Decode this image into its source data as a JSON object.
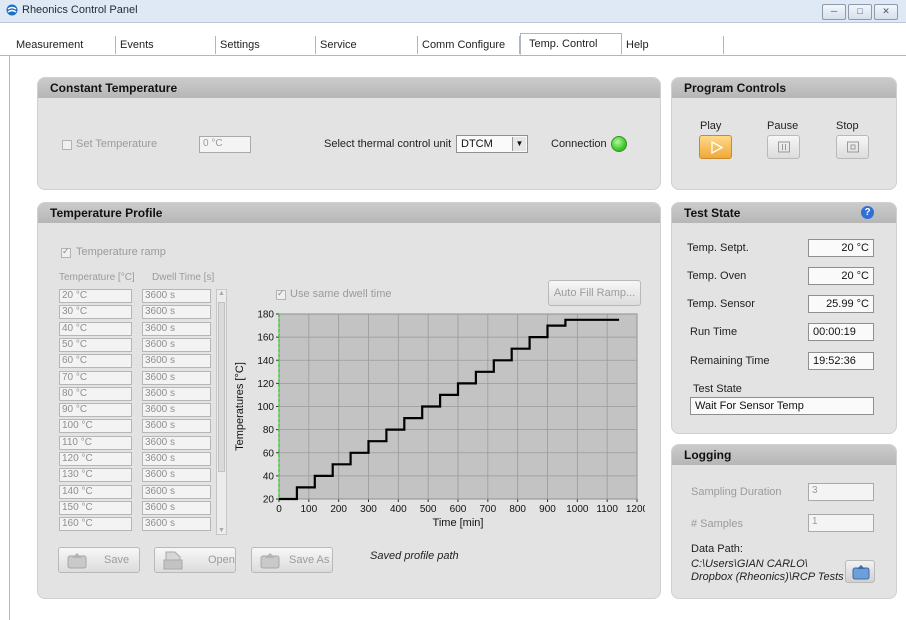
{
  "window": {
    "title": "Rheonics Control Panel"
  },
  "tabs": [
    "Measurement",
    "Events",
    "Settings",
    "Service",
    "Comm Configure",
    "Temp. Control",
    "Help"
  ],
  "active_tab": "Temp. Control",
  "constant_temp": {
    "title": "Constant Temperature",
    "set_temp_label": "Set Temperature",
    "set_temp_value": "0 °C",
    "select_unit_label": "Select thermal control unit",
    "unit_value": "DTCM",
    "connection_label": "Connection",
    "connection_color": "#3ecc2a"
  },
  "program_controls": {
    "title": "Program Controls",
    "play_label": "Play",
    "pause_label": "Pause",
    "stop_label": "Stop",
    "play_color": "#f5b547"
  },
  "profile": {
    "title": "Temperature Profile",
    "ramp_label": "Temperature ramp",
    "col_temp": "Temperature [°C]",
    "col_dwell": "Dwell Time [s]",
    "temps": [
      "20 °C",
      "30 °C",
      "40 °C",
      "50 °C",
      "60 °C",
      "70 °C",
      "80 °C",
      "90 °C",
      "100 °C",
      "110 °C",
      "120 °C",
      "130 °C",
      "140 °C",
      "150 °C",
      "160 °C"
    ],
    "dwells": [
      "3600 s",
      "3600 s",
      "3600 s",
      "3600 s",
      "3600 s",
      "3600 s",
      "3600 s",
      "3600 s",
      "3600 s",
      "3600 s",
      "3600 s",
      "3600 s",
      "3600 s",
      "3600 s",
      "3600 s"
    ],
    "same_dwell_label": "Use same dwell time",
    "auto_fill_label": "Auto Fill Ramp...",
    "save_label": "Save",
    "open_label": "Open",
    "save_as_label": "Save As",
    "saved_path_label": "Saved profile path"
  },
  "chart_data": {
    "type": "line",
    "xlabel": "Time [min]",
    "ylabel": "Temperatures [°C]",
    "xlim": [
      0,
      1200
    ],
    "ylim": [
      20,
      180
    ],
    "xticks": [
      0,
      100,
      200,
      300,
      400,
      500,
      600,
      700,
      800,
      900,
      1000,
      1100,
      1200
    ],
    "yticks": [
      20,
      40,
      60,
      80,
      100,
      120,
      140,
      160,
      180
    ],
    "grid": true,
    "series": [
      {
        "x": [
          0,
          60,
          60,
          120,
          120,
          180,
          180,
          240,
          240,
          300,
          300,
          360,
          360,
          420,
          420,
          480,
          480,
          540,
          540,
          600,
          600,
          660,
          660,
          720,
          720,
          780,
          780,
          840,
          840,
          900,
          900,
          960,
          960,
          1140
        ],
        "y": [
          20,
          20,
          30,
          30,
          40,
          40,
          50,
          50,
          60,
          60,
          70,
          70,
          80,
          80,
          90,
          90,
          100,
          100,
          110,
          110,
          120,
          120,
          130,
          130,
          140,
          140,
          150,
          150,
          160,
          160,
          170,
          170,
          175,
          175
        ]
      }
    ]
  },
  "test_state": {
    "title": "Test State",
    "help_icon": "question-icon",
    "setpt_label": "Temp. Setpt.",
    "setpt_value": "20 °C",
    "oven_label": "Temp. Oven",
    "oven_value": "20 °C",
    "sensor_label": "Temp. Sensor",
    "sensor_value": "25.99 °C",
    "run_label": "Run Time",
    "run_value": "00:00:19",
    "remain_label": "Remaining Time",
    "remain_value": "19:52:36",
    "state_label": "Test State",
    "state_value": "Wait For Sensor Temp"
  },
  "logging": {
    "title": "Logging",
    "duration_label": "Sampling Duration",
    "duration_value": "3",
    "samples_label": "# Samples",
    "samples_value": "1",
    "data_path_label": "Data Path:",
    "data_path_line1": "C:\\Users\\GIAN CARLO\\",
    "data_path_line2": "Dropbox (Rheonics)\\RCP Tests"
  }
}
